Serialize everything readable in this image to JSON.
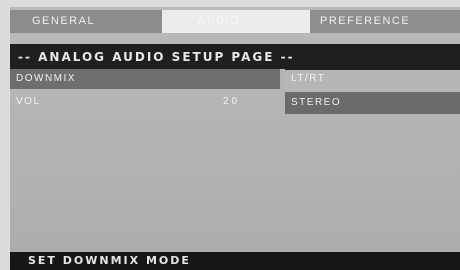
{
  "tabs": [
    {
      "label": "GENERAL",
      "state": "inactive"
    },
    {
      "label": "AUDIO",
      "state": "active"
    },
    {
      "label": "PREFERENCE",
      "state": "inactive"
    }
  ],
  "page": {
    "title": "-- ANALOG AUDIO SETUP PAGE --"
  },
  "settings": [
    {
      "label": "DOWNMIX",
      "value": ""
    },
    {
      "label": "VOL",
      "value": "20"
    }
  ],
  "options": [
    {
      "label": "LT/RT",
      "selected": false
    },
    {
      "label": "STEREO",
      "selected": true
    }
  ],
  "status": {
    "text": "SET DOWNMIX MODE"
  },
  "colors": {
    "background": "#b5b5b5",
    "header_bar": "#1f1f1f",
    "highlight": "#6e6e6e",
    "active_tab": "#ececec",
    "text": "#f2f2f2"
  }
}
